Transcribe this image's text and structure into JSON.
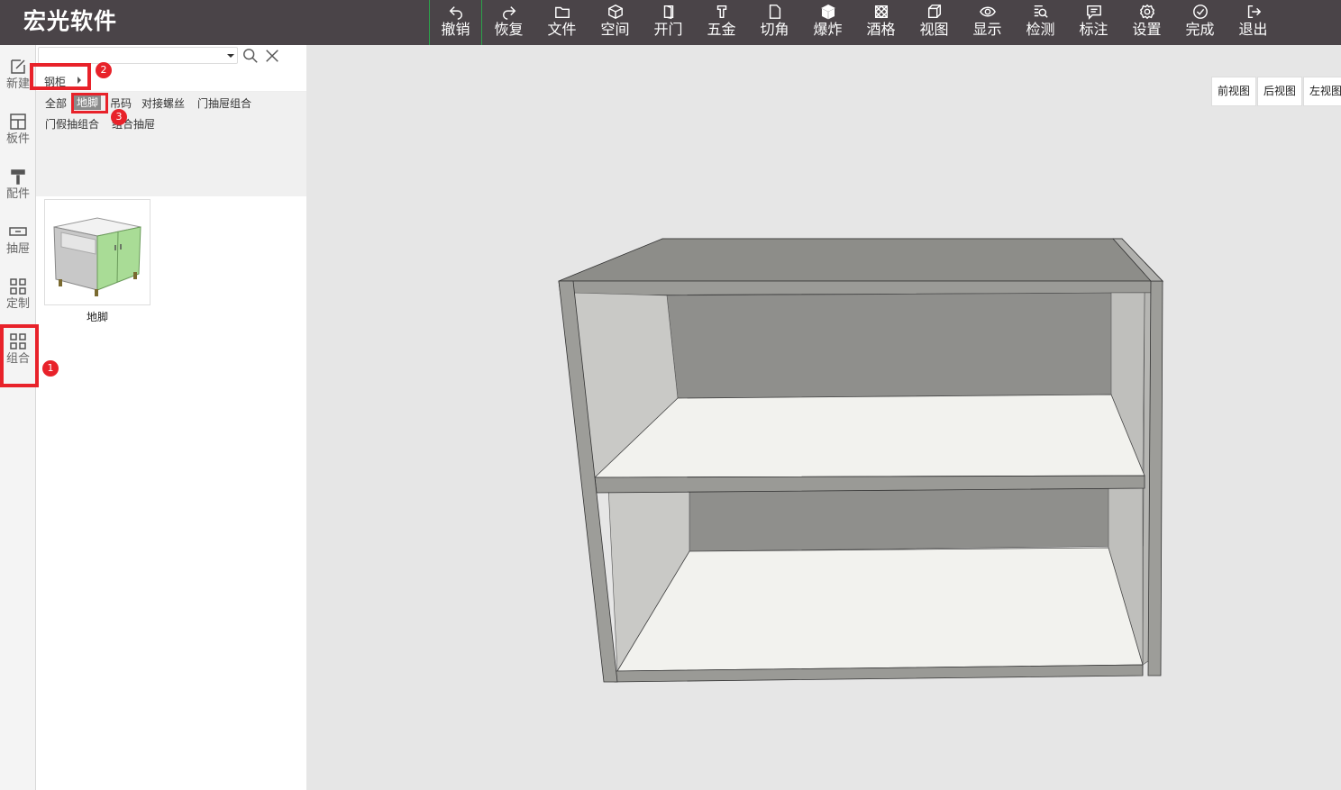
{
  "app": {
    "title": "宏光软件"
  },
  "toolbar": {
    "items": [
      {
        "label": "撤销",
        "icon": "undo-icon"
      },
      {
        "label": "恢复",
        "icon": "redo-icon"
      },
      {
        "label": "文件",
        "icon": "folder-icon"
      },
      {
        "label": "空间",
        "icon": "cube-icon"
      },
      {
        "label": "开门",
        "icon": "door-icon"
      },
      {
        "label": "五金",
        "icon": "hardware-icon"
      },
      {
        "label": "切角",
        "icon": "corner-cut-icon"
      },
      {
        "label": "爆炸",
        "icon": "explode-icon"
      },
      {
        "label": "酒格",
        "icon": "wine-grid-icon"
      },
      {
        "label": "视图",
        "icon": "view-icon"
      },
      {
        "label": "显示",
        "icon": "eye-icon"
      },
      {
        "label": "检测",
        "icon": "inspect-icon"
      },
      {
        "label": "标注",
        "icon": "annotate-icon"
      },
      {
        "label": "设置",
        "icon": "gear-icon"
      },
      {
        "label": "完成",
        "icon": "check-icon"
      },
      {
        "label": "退出",
        "icon": "exit-icon"
      }
    ]
  },
  "sidebar": {
    "items": [
      {
        "label": "新建",
        "icon": "edit-icon"
      },
      {
        "label": "板件",
        "icon": "panel-icon"
      },
      {
        "label": "配件",
        "icon": "roller-icon"
      },
      {
        "label": "抽屉",
        "icon": "drawer-icon"
      },
      {
        "label": "定制",
        "icon": "grid-icon"
      },
      {
        "label": "组合",
        "icon": "grid-icon"
      }
    ]
  },
  "panel": {
    "search": {
      "value": "",
      "placeholder": ""
    },
    "category": {
      "selected": "钢柜"
    },
    "tags": [
      "全部",
      "地脚",
      "吊码",
      "对接螺丝",
      "门抽屉组合",
      "门假抽组合",
      "组合抽屉"
    ],
    "active_tag": "地脚",
    "items": [
      {
        "label": "地脚"
      }
    ]
  },
  "viewport": {
    "view_buttons": [
      "前视图",
      "后视图",
      "左视图"
    ]
  },
  "annotations": {
    "badges": [
      "1",
      "2",
      "3"
    ]
  },
  "colors": {
    "topbar": "#4a4448",
    "callout": "#e8222a",
    "accent_green": "#2ca24a"
  }
}
